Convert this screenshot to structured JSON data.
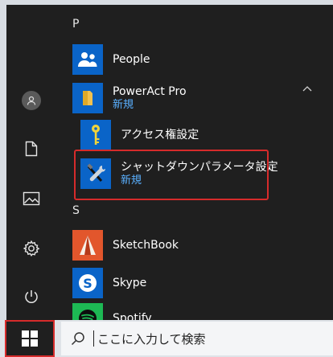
{
  "start_menu": {
    "sections": [
      {
        "letter": "P"
      },
      {
        "letter": "S"
      }
    ],
    "apps": {
      "people": {
        "label": "People"
      },
      "poweract": {
        "label": "PowerAct Pro",
        "sublabel": "新規"
      },
      "access": {
        "label": "アクセス権設定"
      },
      "shutdown": {
        "label": "シャットダウンパラメータ設定",
        "sublabel": "新規"
      },
      "sketchbook": {
        "label": "SketchBook"
      },
      "skype": {
        "label": "Skype"
      },
      "spotify": {
        "label": "Spotify"
      }
    },
    "rail": [
      "user-avatar-icon",
      "documents-icon",
      "pictures-icon",
      "settings-gear-icon",
      "power-icon"
    ]
  },
  "taskbar": {
    "search": {
      "placeholder": "ここに入力して検索"
    }
  },
  "colors": {
    "menu_bg": "#1f1f1f",
    "accent_blue": "#0a64c8",
    "new_badge": "#5ab0ff",
    "highlight_border": "#d62b2b"
  }
}
